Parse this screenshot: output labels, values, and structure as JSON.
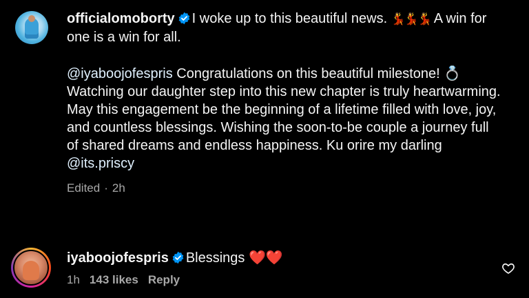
{
  "comments": [
    {
      "username": "officialomoborty",
      "verified": true,
      "line1": "I woke up to this beautiful news. ",
      "emoji1": "💃💃💃",
      "line1_rest": " A win for one is a win for all.",
      "mention": "@iyaboojofespris",
      "para2": " Congratulations on this beautiful milestone! ",
      "ring_emoji": "💍",
      "para3": "Watching our daughter step into this new chapter is truly heartwarming. May this engagement be the beginning of a lifetime filled with love, joy, and countless blessings. Wishing the soon-to-be couple a journey full of shared dreams and endless happiness. Ku orire my darling ",
      "mention2": "@its.priscy",
      "meta_edited": "Edited",
      "meta_sep": "·",
      "meta_time": "2h"
    },
    {
      "username": "iyaboojofespris",
      "verified": true,
      "text": "Blessings ",
      "emoji": "❤️❤️",
      "meta_time": "1h",
      "meta_likes": "143 likes",
      "meta_reply": "Reply"
    }
  ],
  "icons": {
    "verified": "verified-badge-icon",
    "like": "heart-outline-icon"
  },
  "colors": {
    "background": "#000000",
    "text": "#f5f5f5",
    "secondary": "#a8a8a8",
    "verified": "#0095f6"
  }
}
